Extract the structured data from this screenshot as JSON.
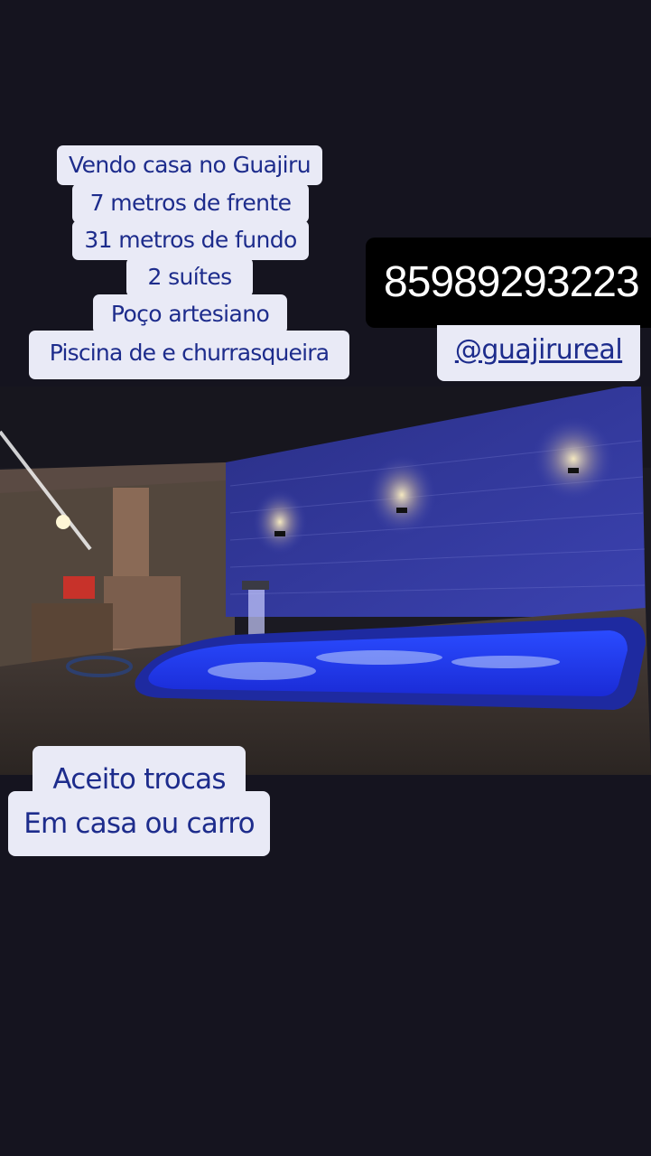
{
  "listing": {
    "lines": [
      "Vendo casa no Guajiru",
      "7 metros de frente",
      "31 metros de fundo",
      "2 suítes",
      "Poço  artesiano",
      "Piscina de e churrasqueira"
    ],
    "phone": "85989293223",
    "handle": "@guajirureal",
    "trade_line1": "Aceito trocas",
    "trade_line2": "Em casa ou carro"
  },
  "colors": {
    "background": "#15141f",
    "pill": "#e9eaf6",
    "text_blue": "#1d2c8c",
    "pool_blue": "#1f3cff"
  }
}
